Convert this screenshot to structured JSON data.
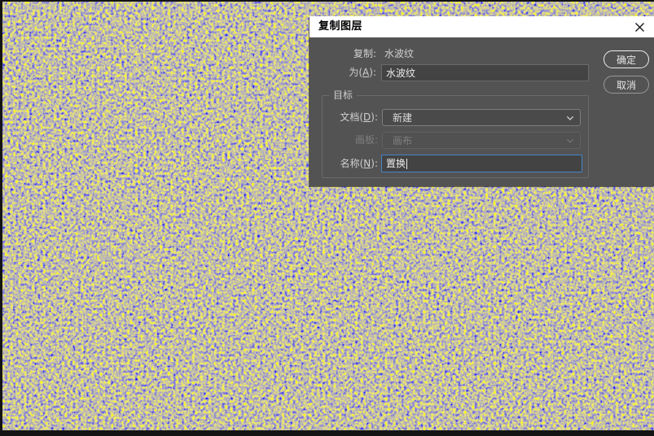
{
  "dialog": {
    "title": "复制图层",
    "close_icon": "close-x",
    "copy_row": {
      "label": "复制:",
      "value": "水波纹"
    },
    "as_row": {
      "label_prefix": "为(",
      "access_key": "A",
      "label_suffix": "):",
      "value": "水波纹"
    },
    "buttons": {
      "ok": "确定",
      "cancel": "取消"
    },
    "destination_group": {
      "title": "目标",
      "document_row": {
        "label_prefix": "文档(",
        "access_key": "D",
        "label_suffix": "):",
        "value": "新建",
        "icon": "chevron-down",
        "enabled": true
      },
      "artboard_row": {
        "label": "画板:",
        "value": "画布",
        "icon": "chevron-down",
        "enabled": false
      },
      "name_row": {
        "label_prefix": "名称(",
        "access_key": "N",
        "label_suffix": "):",
        "value": "置换",
        "focused": true
      }
    }
  },
  "colors": {
    "titlebar_bg": "#ffffff",
    "dialog_body": "#535353",
    "focus_border": "#4486c6",
    "texture_gray": "#8c8773",
    "texture_yellow": "#d8d860",
    "texture_blue": "#2a2ab0"
  }
}
